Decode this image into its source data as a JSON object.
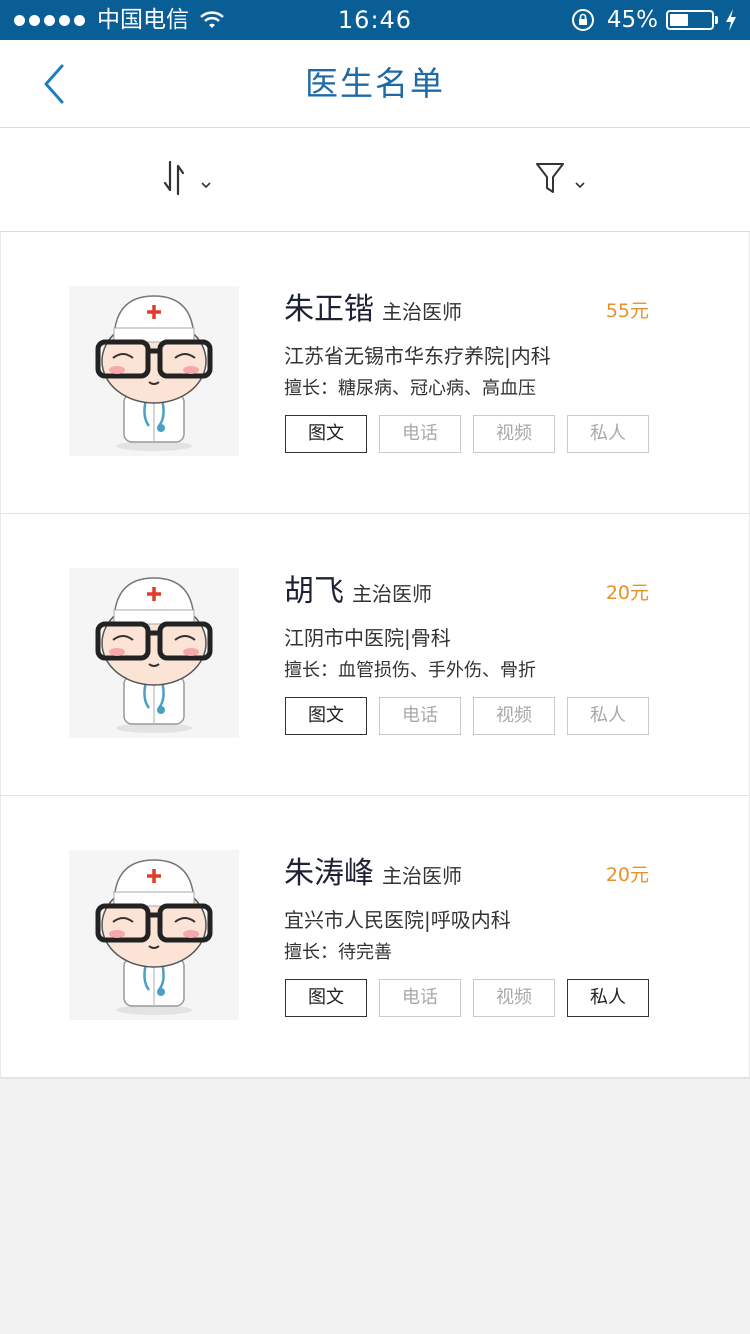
{
  "status_bar": {
    "carrier": "中国电信",
    "time": "16:46",
    "battery": "45%"
  },
  "nav": {
    "title": "医生名单"
  },
  "doctors": [
    {
      "name": "朱正锴",
      "title": "主治医师",
      "price": "55元",
      "hospital": "江苏省无锡市华东疗养院|内科",
      "skill": "擅长：糖尿病、冠心病、高血压",
      "services": [
        {
          "label": "图文",
          "active": true
        },
        {
          "label": "电话",
          "active": false
        },
        {
          "label": "视频",
          "active": false
        },
        {
          "label": "私人",
          "active": false
        }
      ]
    },
    {
      "name": "胡飞",
      "title": "主治医师",
      "price": "20元",
      "hospital": "江阴市中医院|骨科",
      "skill": "擅长：血管损伤、手外伤、骨折",
      "services": [
        {
          "label": "图文",
          "active": true
        },
        {
          "label": "电话",
          "active": false
        },
        {
          "label": "视频",
          "active": false
        },
        {
          "label": "私人",
          "active": false
        }
      ]
    },
    {
      "name": "朱涛峰",
      "title": "主治医师",
      "price": "20元",
      "hospital": "宜兴市人民医院|呼吸内科",
      "skill": "擅长：待完善",
      "services": [
        {
          "label": "图文",
          "active": true
        },
        {
          "label": "电话",
          "active": false
        },
        {
          "label": "视频",
          "active": false
        },
        {
          "label": "私人",
          "active": true
        }
      ]
    }
  ]
}
